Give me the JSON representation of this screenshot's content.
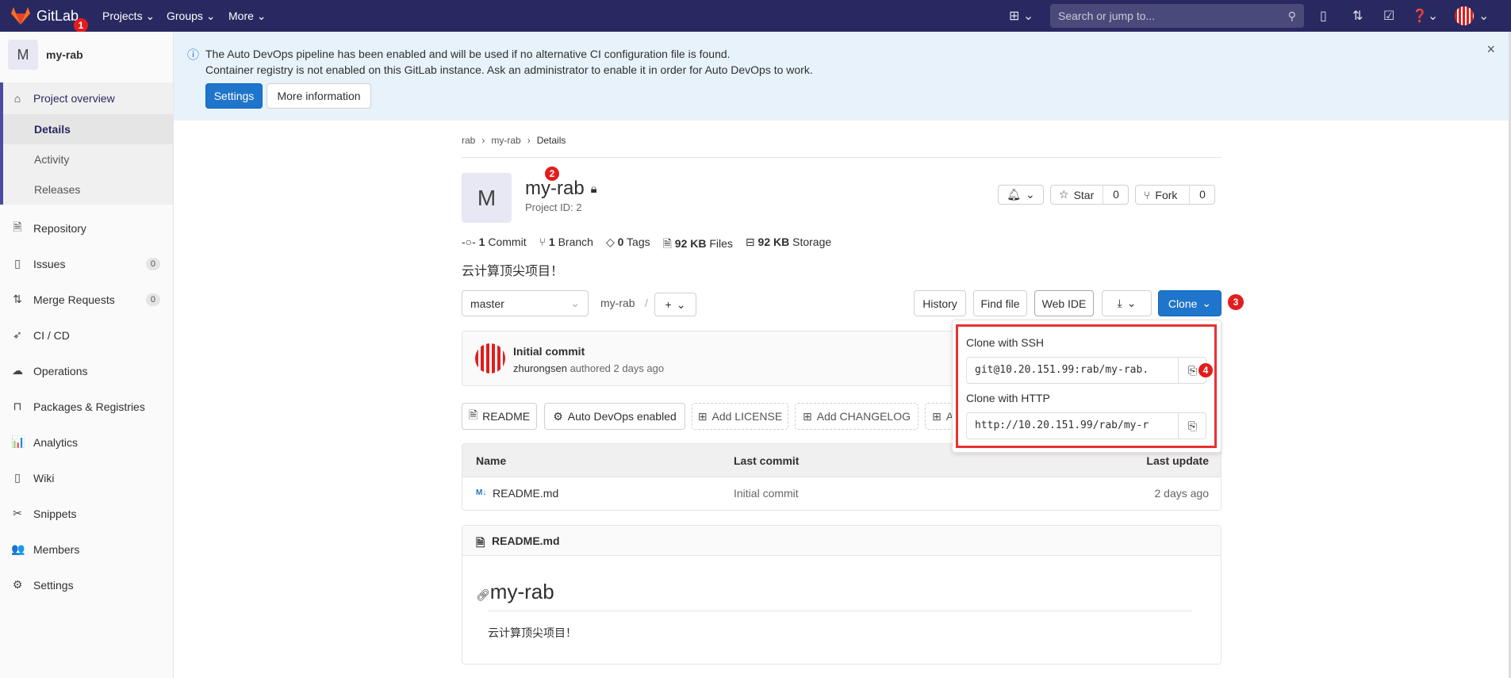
{
  "topnav": {
    "brand": "GitLab",
    "projects": "Projects",
    "groups": "Groups",
    "more": "More",
    "search_placeholder": "Search or jump to...",
    "annotation": "1"
  },
  "sidebar": {
    "project_initial": "M",
    "project_name": "my-rab",
    "overview": "Project overview",
    "sub": [
      "Details",
      "Activity",
      "Releases"
    ],
    "items": [
      {
        "label": "Repository",
        "icon": "file"
      },
      {
        "label": "Issues",
        "icon": "issues",
        "count": "0"
      },
      {
        "label": "Merge Requests",
        "icon": "merge",
        "count": "0"
      },
      {
        "label": "CI / CD",
        "icon": "rocket"
      },
      {
        "label": "Operations",
        "icon": "cloud"
      },
      {
        "label": "Packages & Registries",
        "icon": "package"
      },
      {
        "label": "Analytics",
        "icon": "chart"
      },
      {
        "label": "Wiki",
        "icon": "book"
      },
      {
        "label": "Snippets",
        "icon": "scissors"
      },
      {
        "label": "Members",
        "icon": "users"
      },
      {
        "label": "Settings",
        "icon": "gear"
      }
    ]
  },
  "alert": {
    "line1": "The Auto DevOps pipeline has been enabled and will be used if no alternative CI configuration file is found.",
    "line2": "Container registry is not enabled on this GitLab instance. Ask an administrator to enable it in order for Auto DevOps to work.",
    "settings": "Settings",
    "more_info": "More information"
  },
  "breadcrumb": [
    "rab",
    "my-rab",
    "Details"
  ],
  "project": {
    "initial": "M",
    "name": "my-rab",
    "id": "Project ID: 2",
    "annotation": "2",
    "star": "Star",
    "star_count": "0",
    "fork": "Fork",
    "fork_count": "0",
    "description": "云计算顶尖项目！"
  },
  "stats": [
    {
      "n": "1",
      "label": "Commit"
    },
    {
      "n": "1",
      "label": "Branch"
    },
    {
      "n": "0",
      "label": "Tags"
    },
    {
      "n": "92 KB",
      "label": "Files"
    },
    {
      "n": "92 KB",
      "label": "Storage"
    }
  ],
  "toolbar": {
    "branch": "master",
    "path": "my-rab",
    "sep": "/",
    "history": "History",
    "find_file": "Find file",
    "web_ide": "Web IDE",
    "clone": "Clone",
    "annotation": "3"
  },
  "commit": {
    "title": "Initial commit",
    "author": "zhurongsen",
    "authored": "authored 2 days ago"
  },
  "clone_dropdown": {
    "ssh_label": "Clone with SSH",
    "ssh_url": "git@10.20.151.99:rab/my-rab.",
    "http_label": "Clone with HTTP",
    "http_url": "http://10.20.151.99/rab/my-r",
    "annotation": "4"
  },
  "quick_buttons": [
    "README",
    "Auto DevOps enabled",
    "Add LICENSE",
    "Add CHANGELOG",
    "A"
  ],
  "table": {
    "headers": [
      "Name",
      "Last commit",
      "Last update"
    ],
    "rows": [
      {
        "name": "README.md",
        "commit": "Initial commit",
        "updated": "2 days ago"
      }
    ]
  },
  "readme": {
    "filename": "README.md",
    "heading": "my-rab",
    "body": "云计算顶尖项目！"
  },
  "colors": {
    "nav": "#292961",
    "primary": "#1f75cb",
    "annotation": "#e21d1d",
    "alert_bg": "#e8f2fb"
  }
}
